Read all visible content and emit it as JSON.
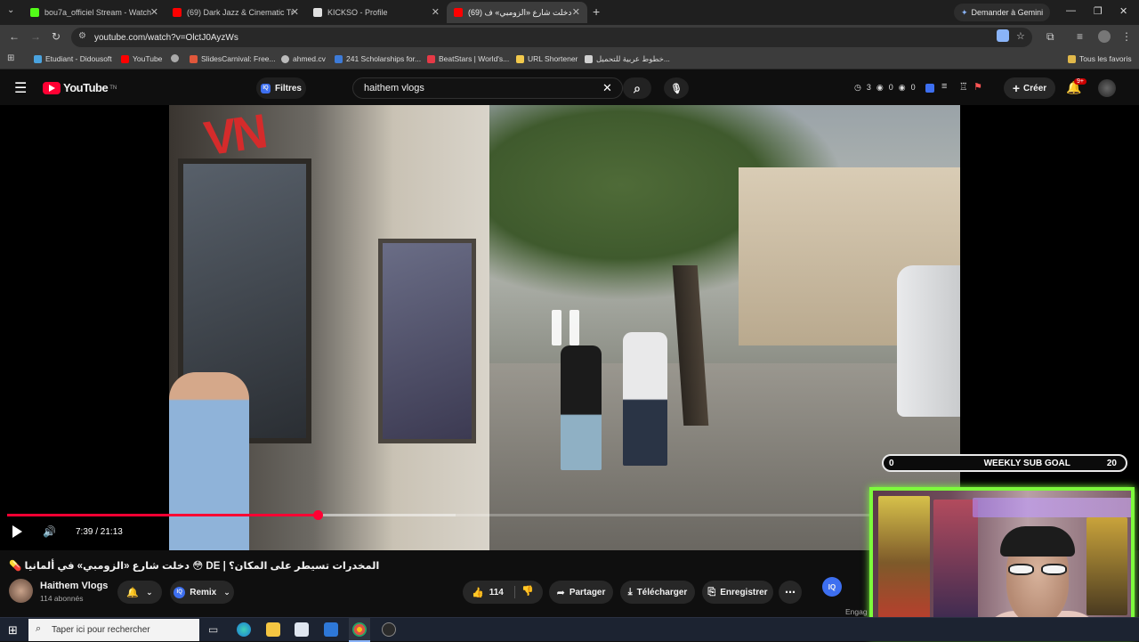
{
  "browser": {
    "tabs": [
      {
        "title": "bou7a_officiel Stream - Watch L",
        "favicon_color": "#53fc18"
      },
      {
        "title": "(69) Dark Jazz & Cinematic Trip",
        "favicon_color": "#ff0000"
      },
      {
        "title": "KICKSO - Profile",
        "favicon_color": "#e0e0e0"
      },
      {
        "title": "(69) دخلت شارع «الزومبي» ف",
        "favicon_color": "#ff0000",
        "active": true
      }
    ],
    "gemini_label": "Demander à Gemini",
    "url": "youtube.com/watch?v=OlctJ0AyzWs",
    "bookmarks": [
      {
        "label": "Etudiant - Didousoft"
      },
      {
        "label": "YouTube"
      },
      {
        "label": ""
      },
      {
        "label": "SlidesCarnival: Free..."
      },
      {
        "label": "ahmed.cv"
      },
      {
        "label": "241 Scholarships for..."
      },
      {
        "label": "BeatStars | World's..."
      },
      {
        "label": "URL Shortener"
      },
      {
        "label": "خطوط عربية للتحميل..."
      }
    ],
    "all_favorites": "Tous les favoris"
  },
  "youtube": {
    "logo_text": "YouTube",
    "logo_country": "TN",
    "filters_label": "Filtres",
    "search_value": "haithem vlogs",
    "stats": {
      "a": "3",
      "b": "0",
      "c": "0"
    },
    "create_label": "Créer",
    "notif_badge": "9+"
  },
  "player": {
    "time_label": "7:39 / 21:13",
    "progress_fraction": 0.36,
    "buffer_fraction": 0.52,
    "overlay_goal": {
      "left": "0",
      "label": "WEEKLY SUB GOAL",
      "right": "20"
    }
  },
  "video": {
    "title": "المخدرات تسيطر على المكان؟ | DE 😳 دخلت شارع «الزومبي» في ألمانيا 💊",
    "channel_name": "Haithem Vlogs",
    "subscribers": "114 abonnés",
    "remix_label": "Remix",
    "likes": "114",
    "share_label": "Partager",
    "download_label": "Télécharger",
    "save_label": "Enregistrer",
    "engage_label": "Engag"
  },
  "taskbar": {
    "search_placeholder": "Taper ici pour rechercher"
  },
  "colors": {
    "yt_red": "#ff0033",
    "webcam_border": "#7dfc3c"
  }
}
